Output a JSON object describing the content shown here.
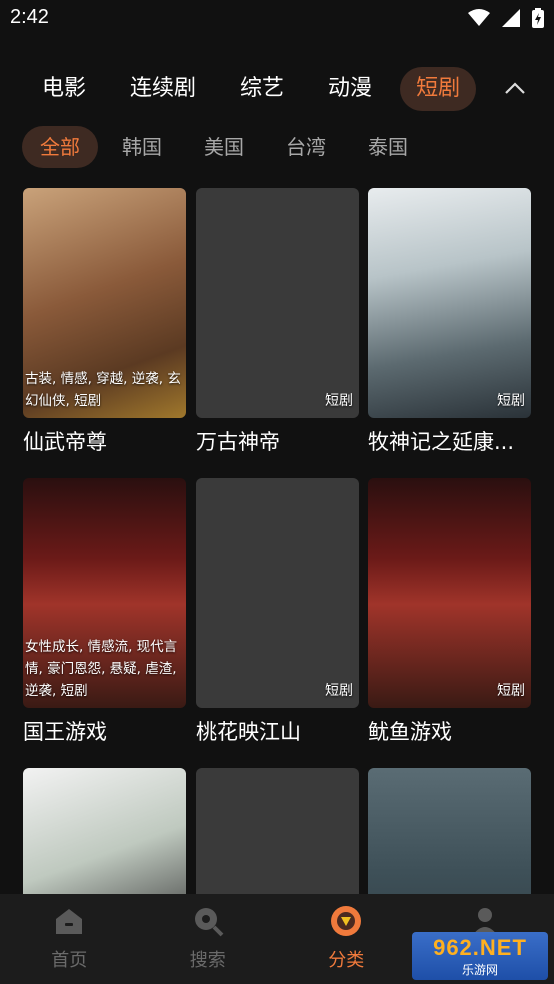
{
  "status_bar": {
    "time": "2:42"
  },
  "categories": [
    {
      "label": "电影",
      "active": false
    },
    {
      "label": "连续剧",
      "active": false
    },
    {
      "label": "综艺",
      "active": false
    },
    {
      "label": "动漫",
      "active": false
    },
    {
      "label": "短剧",
      "active": true
    }
  ],
  "regions": [
    {
      "label": "全部",
      "active": true
    },
    {
      "label": "韩国",
      "active": false
    },
    {
      "label": "美国",
      "active": false
    },
    {
      "label": "台湾",
      "active": false
    },
    {
      "label": "泰国",
      "active": false
    }
  ],
  "cards": [
    {
      "title": "仙武帝尊",
      "tags": "古装, 情感, 穿越, 逆袭, 玄幻仙侠, 短剧",
      "badge": "",
      "poster": "warm"
    },
    {
      "title": "万古神帝",
      "tags": "",
      "badge": "短剧",
      "poster": "blank"
    },
    {
      "title": "牧神记之延康...",
      "tags": "",
      "badge": "短剧",
      "poster": "mist"
    },
    {
      "title": "国王游戏",
      "tags": "女性成长, 情感流, 现代言情, 豪门恩怨, 悬疑, 虐渣, 逆袭, 短剧",
      "badge": "",
      "poster": "red"
    },
    {
      "title": "桃花映江山",
      "tags": "",
      "badge": "短剧",
      "poster": "blank"
    },
    {
      "title": "鱿鱼游戏",
      "tags": "",
      "badge": "短剧",
      "poster": "red"
    },
    {
      "title": "",
      "tags": "",
      "badge": "",
      "poster": "bw"
    },
    {
      "title": "",
      "tags": "",
      "badge": "",
      "poster": "blank"
    },
    {
      "title": "",
      "tags": "",
      "badge": "",
      "poster": "teal"
    }
  ],
  "bottom_nav": [
    {
      "label": "首页",
      "icon": "home-icon",
      "active": false
    },
    {
      "label": "搜索",
      "icon": "search-icon",
      "active": false
    },
    {
      "label": "分类",
      "icon": "category-icon",
      "active": true
    },
    {
      "label": "",
      "icon": "profile-icon",
      "active": false
    }
  ],
  "watermark": {
    "main": "962.NET",
    "sub": "乐游网"
  },
  "colors": {
    "accent": "#f07a3c",
    "active_bg": "#3e2a22",
    "background": "#111111"
  }
}
